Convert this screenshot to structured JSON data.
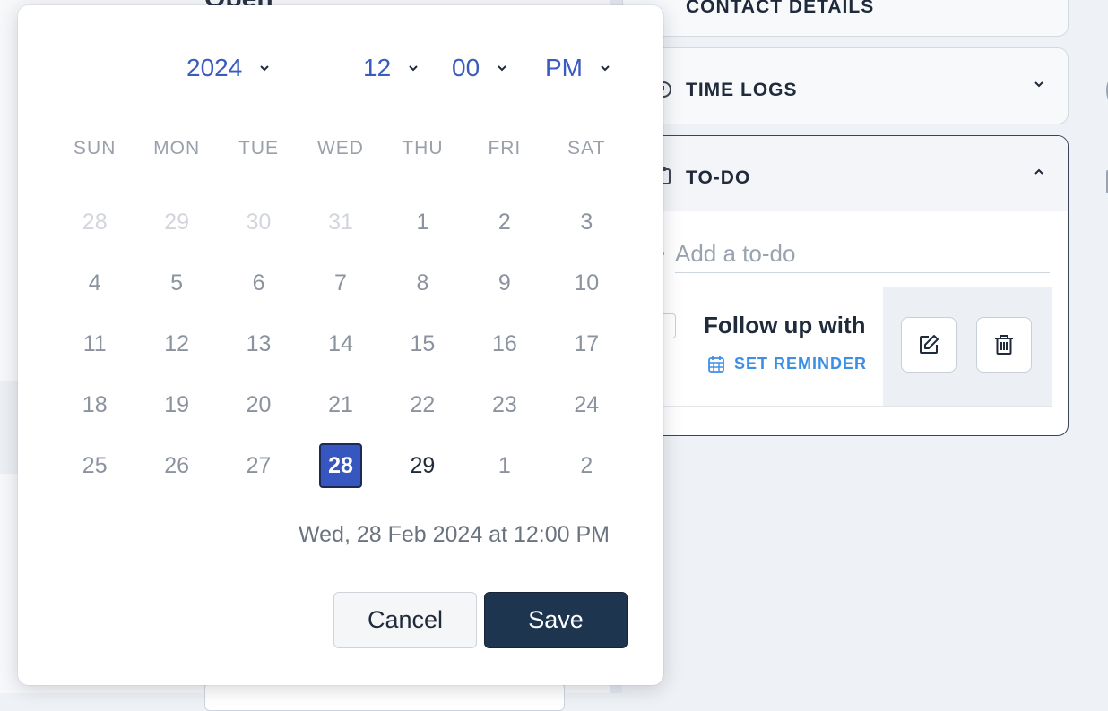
{
  "background": {
    "status_text": "Open"
  },
  "right_panels": {
    "contact_details": {
      "title": "CONTACT DETAILS",
      "icon": "compass-icon"
    },
    "time_logs": {
      "title": "TIME LOGS",
      "icon": "stopwatch-icon"
    },
    "todo": {
      "title": "TO-DO",
      "icon": "clipboard-icon",
      "add_placeholder": "Add a to-do",
      "items": [
        {
          "text": "Follow up with",
          "reminder_label": "SET REMINDER"
        }
      ]
    }
  },
  "date_picker": {
    "year": "2024",
    "hour": "12",
    "minute": "00",
    "ampm": "PM",
    "weekdays": [
      "SUN",
      "MON",
      "TUE",
      "WED",
      "THU",
      "FRI",
      "SAT"
    ],
    "weeks": [
      [
        "28",
        "29",
        "30",
        "31",
        "1",
        "2",
        "3"
      ],
      [
        "4",
        "5",
        "6",
        "7",
        "8",
        "9",
        "10"
      ],
      [
        "11",
        "12",
        "13",
        "14",
        "15",
        "16",
        "17"
      ],
      [
        "18",
        "19",
        "20",
        "21",
        "22",
        "23",
        "24"
      ],
      [
        "25",
        "26",
        "27",
        "28",
        "29",
        "1",
        "2"
      ]
    ],
    "selected_day": "28",
    "summary": "Wed, 28 Feb 2024 at 12:00 PM",
    "cancel_label": "Cancel",
    "save_label": "Save"
  },
  "colors": {
    "accent": "#3656c0",
    "selector_text": "#3a5bbf",
    "save_button": "#1e3550",
    "reminder_link": "#3d8fe6"
  }
}
